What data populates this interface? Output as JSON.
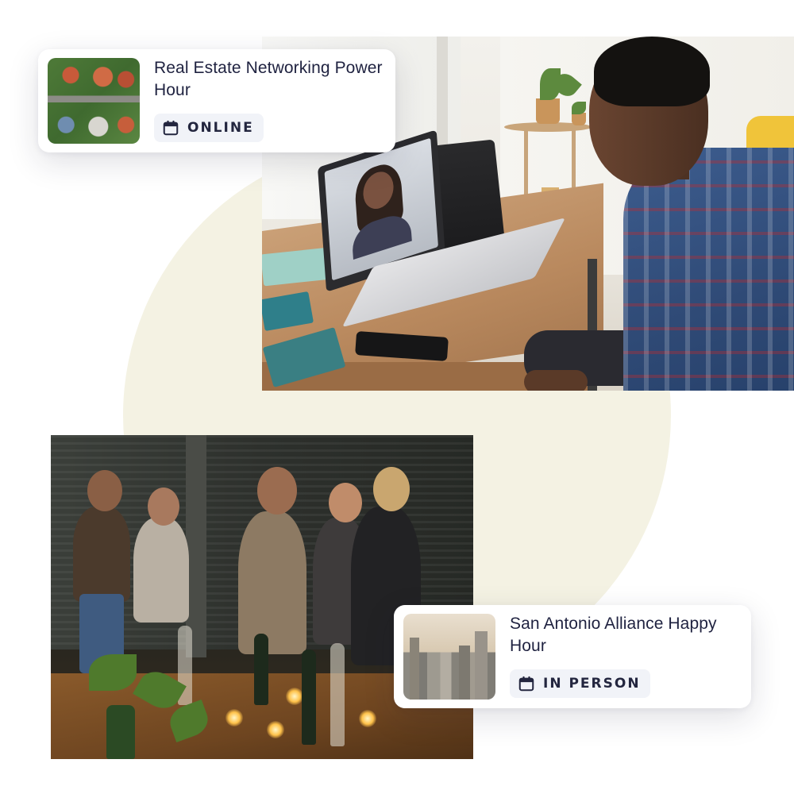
{
  "events": [
    {
      "title": "Real Estate Networking Power Hour",
      "format_label": "ONLINE",
      "thumbnail_icon": "aerial-neighborhood-image",
      "badge_icon": "calendar-icon"
    },
    {
      "title": "San Antonio Alliance Happy Hour",
      "format_label": "IN PERSON",
      "thumbnail_icon": "city-skyline-image",
      "badge_icon": "calendar-icon"
    }
  ],
  "photos": {
    "video_call": "man-on-video-call-photo",
    "party": "networking-party-photo"
  },
  "colors": {
    "card_title": "#1f2240",
    "badge_background": "#f1f3f8",
    "badge_text": "#23263f",
    "background_circle": "#f4f2e3"
  }
}
